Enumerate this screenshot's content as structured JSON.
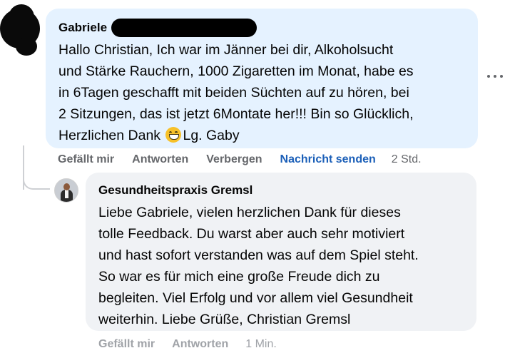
{
  "comment": {
    "author": "Gabriele",
    "text_before_emoji": "Hallo Christian, Ich war im Jänner bei dir, Alkoholsucht\nund Stärke Rauchern, 1000 Zigaretten im Monat, habe es\nin 6Tagen geschafft mit beiden Süchten auf zu hören, bei\n2 Sitzungen, das ist jetzt 6Montate her!!! Bin so Glücklich,\nHerzlichen Dank",
    "text_after_emoji": "Lg. Gaby",
    "emoji_icon": "grinning-face-icon",
    "actions": {
      "like": "Gefällt mir",
      "reply": "Antworten",
      "hide": "Verbergen",
      "message": "Nachricht senden",
      "time": "2 Std."
    }
  },
  "reply": {
    "author": "Gesundheitspraxis Gremsl",
    "text": "Liebe Gabriele, vielen herzlichen Dank für dieses\ntolle Feedback. Du warst aber auch sehr motiviert\nund hast sofort verstanden was auf dem Spiel steht.\nSo war es für mich eine große Freude dich zu\nbegleiten. Viel Erfolg und vor allem viel Gesundheit\nweiterhin. Liebe Grüße, Christian Gremsl",
    "actions": {
      "like": "Gefällt mir",
      "reply": "Antworten",
      "time": "1 Min."
    }
  },
  "colors": {
    "comment_bubble": "#e5f2ff",
    "reply_bubble": "#f0f2f5",
    "link_blue": "#1b5fb8",
    "meta_gray": "#65676b"
  }
}
